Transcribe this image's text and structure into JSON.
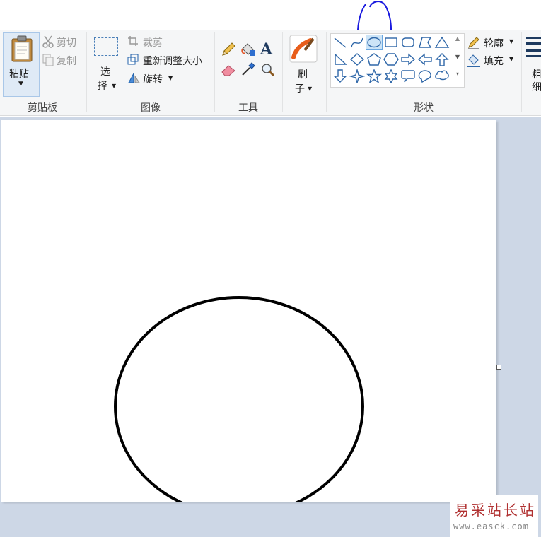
{
  "clipboard": {
    "paste_label": "粘贴",
    "cut_label": "剪切",
    "copy_label": "复制",
    "group_label": "剪贴板"
  },
  "image": {
    "select_label_1": "选",
    "select_label_2": "择",
    "crop_label": "裁剪",
    "resize_label": "重新调整大小",
    "rotate_label": "旋转",
    "group_label": "图像"
  },
  "tools": {
    "text_glyph": "A",
    "group_label": "工具"
  },
  "brushes": {
    "label_1": "刷",
    "label_2": "子",
    "group_label": ""
  },
  "shapes": {
    "items": [
      "line",
      "curve",
      "oval",
      "rectangle",
      "rounded-rectangle",
      "polygon",
      "triangle",
      "right-triangle",
      "diamond",
      "pentagon",
      "hexagon",
      "right-arrow",
      "left-arrow",
      "up-arrow",
      "down-arrow",
      "four-point-star",
      "five-point-star",
      "six-point-star",
      "rounded-callout",
      "oval-callout",
      "cloud-callout"
    ],
    "selected": "oval",
    "outline_label": "轮廓",
    "fill_label": "填充",
    "group_label": "形状"
  },
  "size": {
    "label_1": "粗",
    "label_2": "细"
  },
  "watermark": {
    "title": "易采站长站",
    "url": "www.easck.com"
  },
  "colors": {
    "annotation": "#1a1adf",
    "ribbon_bg": "#f5f6f7",
    "canvas_area_bg": "#cdd7e6",
    "selected_shape_bg": "#cce4f7"
  }
}
